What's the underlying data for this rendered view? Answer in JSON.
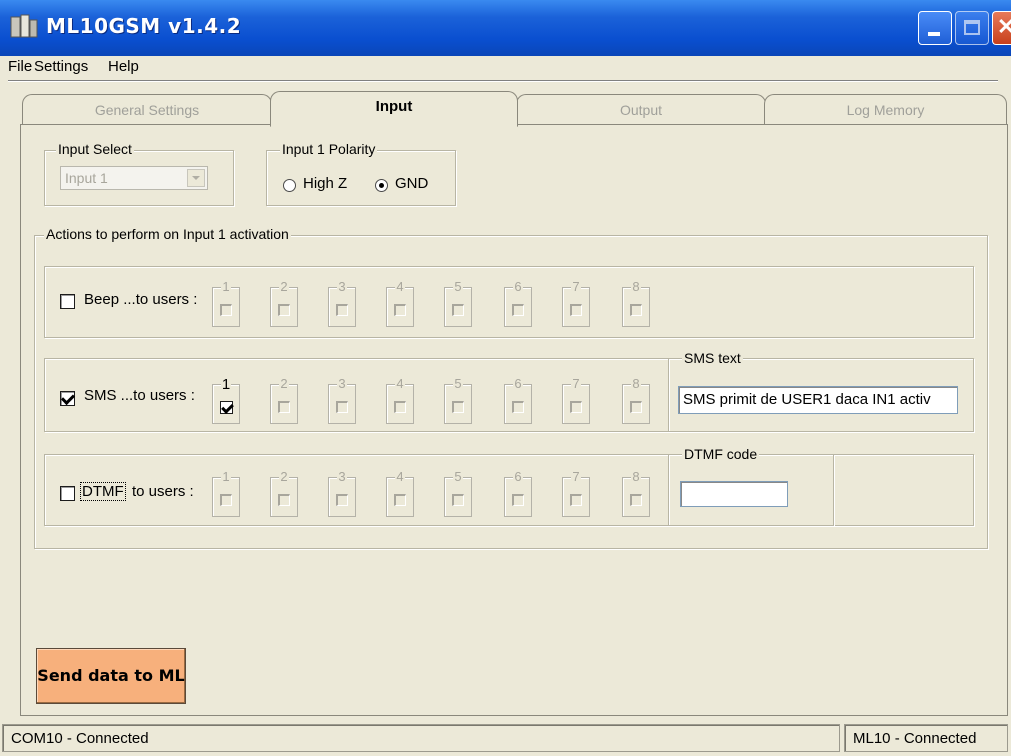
{
  "window": {
    "title": "ML10GSM v1.4.2"
  },
  "menu": [
    "File",
    "Settings",
    "Help"
  ],
  "tabs": [
    {
      "label": "General Settings",
      "active": false
    },
    {
      "label": "Input",
      "active": true
    },
    {
      "label": "Output",
      "active": false
    },
    {
      "label": "Log Memory",
      "active": false
    }
  ],
  "input_select": {
    "label": "Input Select",
    "value": "Input 1"
  },
  "polarity": {
    "label": "Input 1 Polarity",
    "options": [
      "High Z",
      "GND"
    ],
    "selected": "GND"
  },
  "actions": {
    "label": "Actions to perform on Input 1 activation",
    "users": [
      "1",
      "2",
      "3",
      "4",
      "5",
      "6",
      "7",
      "8"
    ],
    "beep": {
      "label": "Beep ...to users :",
      "checked": false
    },
    "sms": {
      "label": "SMS ...to users :",
      "checked": true,
      "text_label": "SMS text",
      "text_value": "SMS primit de USER1 daca IN1 activ"
    },
    "dtmf": {
      "label_key": "DTMF",
      "label_rest": "to users :",
      "checked": false,
      "code_label": "DTMF code",
      "code_value": ""
    }
  },
  "send_button": "Send data to ML",
  "status": {
    "left": "COM10 - Connected",
    "right": "ML10 - Connected"
  },
  "colors": {
    "titlebar": "#0a4fd0",
    "send_button": "#f7b07c",
    "window_bg": "#ece9d8"
  }
}
